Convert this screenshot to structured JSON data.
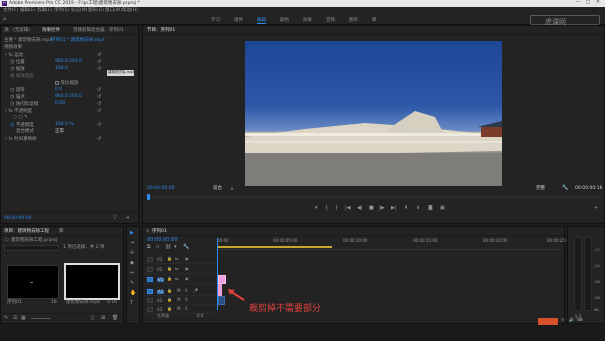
{
  "app": {
    "title": "Adobe Premiere Pro CC 2019 - F:\\pr工程\\建筑物去除.prproj *",
    "menu": [
      "文件(F)",
      "编辑(E)",
      "剪辑(C)",
      "序列(S)",
      "标记(M)",
      "图形(G)",
      "窗口(W)",
      "帮助(H)"
    ]
  },
  "workspace_tabs": [
    "学习",
    "组件",
    "编辑",
    "颜色",
    "效果",
    "音频",
    "图形",
    "库"
  ],
  "workspace_active": "编辑",
  "watermark": "虎课网",
  "effect_controls": {
    "tabs": [
      "源：(无剪辑)",
      "效果控件",
      "音频剪辑混合器：序列01",
      "元数据"
    ],
    "clip_header": "主要 * 建筑物去除.mp4",
    "sequence_clip": "序列01 * 建筑物去除.mp4",
    "section_video": "视频效果",
    "mini_clip_label": "建筑物去除.mp4",
    "rows": [
      {
        "indent": 1,
        "label": "fx 运动"
      },
      {
        "indent": 2,
        "label": "位置",
        "v1": "960.0",
        "v2": "540.0"
      },
      {
        "indent": 2,
        "label": "缩放",
        "v1": "100.0"
      },
      {
        "indent": 2,
        "label": "缩放宽度"
      },
      {
        "indent": 3,
        "label": "等比缩放",
        "check": "✓"
      },
      {
        "indent": 2,
        "label": "旋转",
        "v1": "0.0"
      },
      {
        "indent": 2,
        "label": "锚点",
        "v1": "960.0",
        "v2": "540.0"
      },
      {
        "indent": 2,
        "label": "防闪烁滤镜",
        "v1": "0.00"
      },
      {
        "indent": 1,
        "label": "fx 不透明度"
      },
      {
        "indent": 2,
        "label": "",
        "shapes": "○ □ ✎"
      },
      {
        "indent": 2,
        "label": "不透明度",
        "v1": "100.0 %"
      },
      {
        "indent": 2,
        "label": "混合模式",
        "v1": "正常"
      },
      {
        "indent": 1,
        "label": "fx 时间重映射"
      }
    ],
    "timecode": "00:00:00:00"
  },
  "program": {
    "tab": "节目：序列01",
    "timecode_left": "00:00:00:00",
    "fit": "适合",
    "quality": "完整",
    "timecode_right": "00:00:00:16"
  },
  "project": {
    "tabs": [
      "项目：建筑物去除工程",
      "库"
    ],
    "project_file": "建筑物去除工程.prproj",
    "item_count": "1 项已选择，共 2 项",
    "items": [
      {
        "name": "序列01",
        "duration": "16"
      },
      {
        "name": "建筑物去除.mp4",
        "duration": "0:16"
      }
    ]
  },
  "tools": [
    "▶",
    "⇥",
    "✢",
    "◆",
    "↔",
    "✎",
    "✋",
    "T"
  ],
  "timeline": {
    "tab": "序列01",
    "timecode": "00:00:00:00",
    "ruler": [
      "00:00",
      "00:00:05:00",
      "00:00:10:00",
      "00:00:15:00",
      "00:00:20:00",
      "00:00:25:00"
    ],
    "video_tracks": [
      "V3",
      "V2",
      "V1"
    ],
    "audio_tracks": [
      "A1",
      "A2",
      "A3"
    ],
    "master": "主声道",
    "master_value": "0.0",
    "annotation": "裁剪掉不需要部分"
  },
  "audio_meter": {
    "labels": [
      "-12",
      "-24",
      "-36",
      "-48",
      "dB"
    ],
    "bottom": "S S"
  },
  "colors": {
    "accent": "#2d8ceb",
    "clip": "#e9a0d6",
    "annotation_text": "#e0413c",
    "sky": "#2d58a8"
  }
}
